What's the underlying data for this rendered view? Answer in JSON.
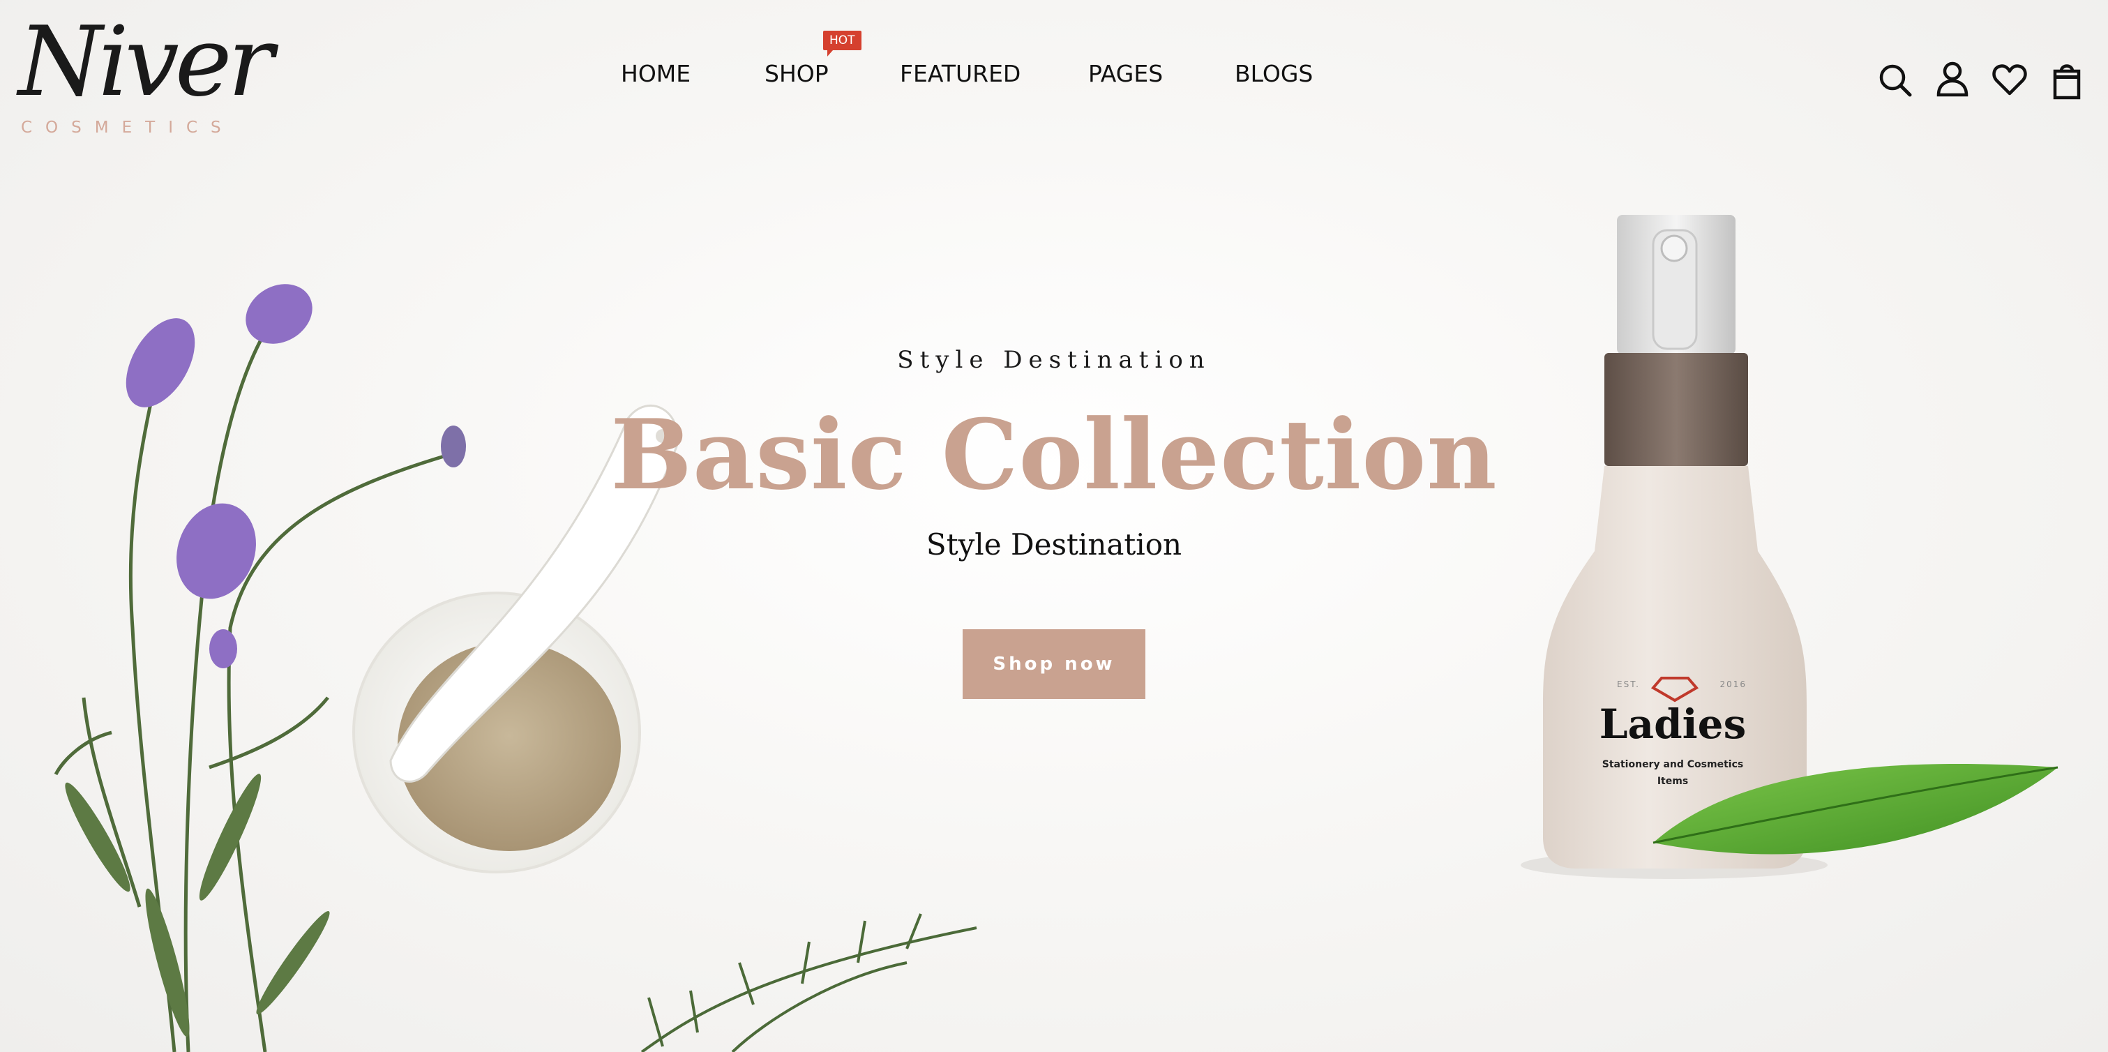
{
  "brand": {
    "logo_script": "Niver",
    "logo_sub": "COSMETICS"
  },
  "nav": {
    "items": [
      {
        "label": "HOME"
      },
      {
        "label": "SHOP",
        "badge": "HOT"
      },
      {
        "label": "FEATURED"
      },
      {
        "label": "PAGES"
      },
      {
        "label": "BLOGS"
      }
    ]
  },
  "header_icons": [
    "search-icon",
    "user-icon",
    "heart-icon",
    "shopping-bag-icon"
  ],
  "hero": {
    "eyebrow": "Style Destination",
    "headline": "Basic Collection",
    "subhead": "Style Destination",
    "cta_label": "Shop now"
  },
  "product_label": {
    "est": "EST.",
    "year": "2016",
    "brand": "Ladies",
    "line1": "Stationery and Cosmetics",
    "line2": "Items"
  },
  "colors": {
    "accent": "#c9a290",
    "badge": "#d5402e",
    "text": "#111111"
  }
}
